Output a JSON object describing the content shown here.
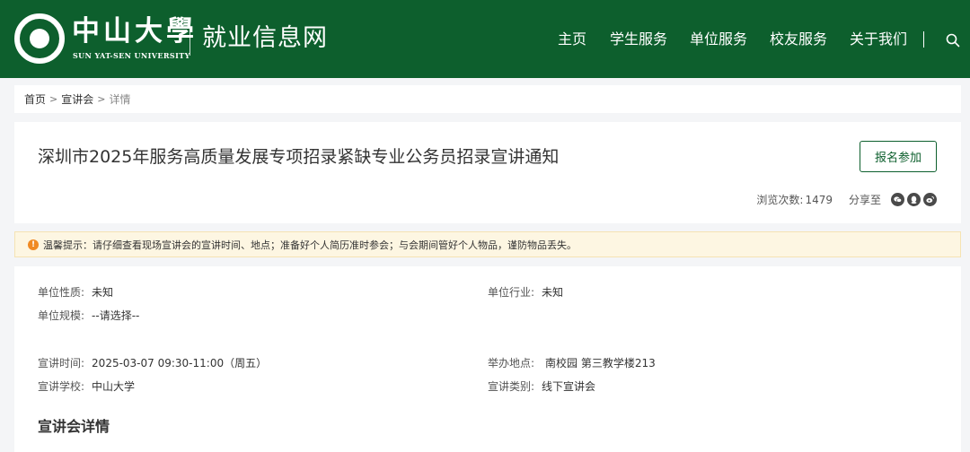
{
  "header": {
    "univ_name": "中山大學",
    "univ_en": "SUN YAT-SEN UNIVERSITY",
    "site_title": "就业信息网",
    "nav": [
      "主页",
      "学生服务",
      "单位服务",
      "校友服务",
      "关于我们"
    ],
    "search_icon": "search-icon",
    "bg_color": "#0d5f2d"
  },
  "breadcrumb": {
    "home": "首页",
    "section": "宣讲会",
    "current": "详情"
  },
  "title_card": {
    "title": "深圳市2025年服务高质量发展专项招录紧缺专业公务员招录宣讲通知",
    "signup_label": "报名参加",
    "views_label": "浏览次数:",
    "views_count": "1479",
    "share_label": "分享至",
    "share_icons": [
      "wechat-icon",
      "qq-icon",
      "weibo-icon"
    ]
  },
  "notice": {
    "text": "温馨提示：请仔细查看现场宣讲会的宣讲时间、地点；准备好个人简历准时参会；与会期间管好个人物品，谨防物品丢失。"
  },
  "info": {
    "unit_nature_label": "单位性质:",
    "unit_nature": "未知",
    "unit_industry_label": "单位行业:",
    "unit_industry": "未知",
    "unit_scale_label": "单位规模:",
    "unit_scale": "--请选择--",
    "talk_time_label": "宣讲时间:",
    "talk_time": "2025-03-07 09:30-11:00（周五）",
    "venue_label": "举办地点:",
    "venue": "南校园 第三教学楼213",
    "school_label": "宣讲学校:",
    "school": "中山大学",
    "category_label": "宣讲类别:",
    "category": "线下宣讲会",
    "section_title": "宣讲会详情"
  }
}
